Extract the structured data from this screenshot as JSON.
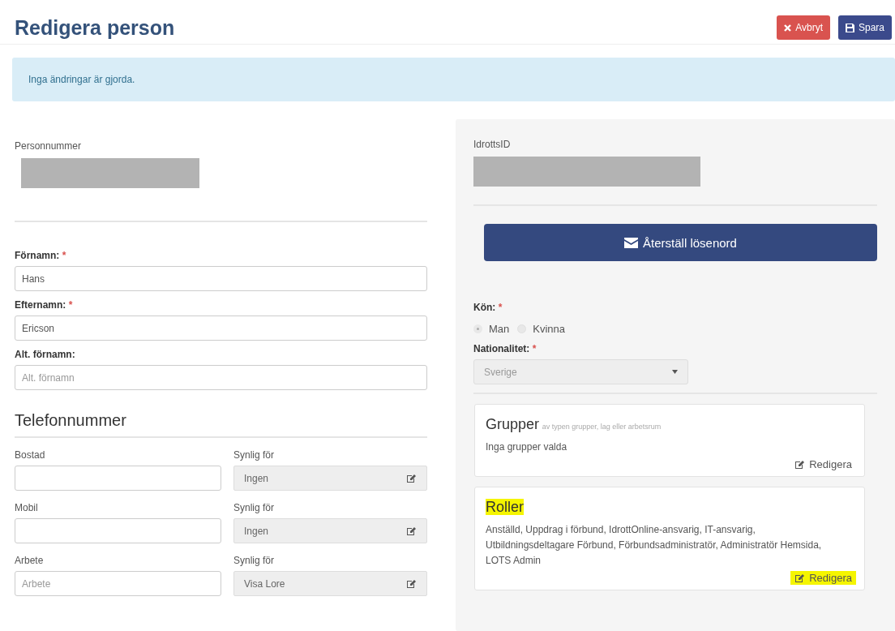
{
  "header": {
    "title": "Redigera person",
    "buttons": [
      {
        "kind": "cancel",
        "label": "Avbryt"
      },
      {
        "kind": "save",
        "label": "Spara"
      }
    ]
  },
  "alert": {
    "text": "Inga ändringar är gjorda."
  },
  "left": {
    "personnummer": {
      "label": "Personnummer"
    },
    "name_fields": [
      {
        "label": "Förnamn:",
        "required_mark": "*",
        "value": "Hans"
      },
      {
        "label": "Efternamn:",
        "required_mark": "*",
        "value": "Ericson"
      },
      {
        "label": "Alt. förnamn:",
        "placeholder": "Alt. förnamn"
      }
    ],
    "phone_section": {
      "title": "Telefonnummer",
      "rows": [
        {
          "label": "Bostad",
          "visibility_label": "Synlig för",
          "visibility": "Ingen"
        },
        {
          "label": "Mobil",
          "visibility_label": "Synlig för",
          "visibility": "Ingen"
        },
        {
          "label": "Arbete",
          "placeholder": "Arbete",
          "visibility_label": "Synlig för",
          "visibility": "Visa Lore"
        }
      ]
    }
  },
  "right": {
    "idrotts_id": {
      "label": "IdrottsID"
    },
    "reset_button": {
      "label": "Återställ lösenord"
    },
    "gender": {
      "label": "Kön:",
      "required_mark": "*",
      "options": [
        {
          "label": "Man",
          "selected": true
        },
        {
          "label": "Kvinna",
          "selected": false
        }
      ]
    },
    "nationality": {
      "label": "Nationalitet:",
      "required_mark": "*",
      "value": "Sverige"
    },
    "cards": [
      {
        "title": "Grupper",
        "subtitle": "av typen grupper, lag eller arbetsrum",
        "title_highlighted": false,
        "body": "Inga grupper valda",
        "edit_label": "Redigera",
        "edit_highlighted": false
      },
      {
        "title": "Roller",
        "title_highlighted": true,
        "body": "Anställd, Uppdrag i förbund, IdrottOnline-ansvarig, IT-ansvarig, Utbildningsdeltagare Förbund, Förbundsadministratör, Administratör Hemsida, LOTS Admin",
        "edit_label": "Redigera",
        "edit_highlighted": true
      }
    ]
  }
}
